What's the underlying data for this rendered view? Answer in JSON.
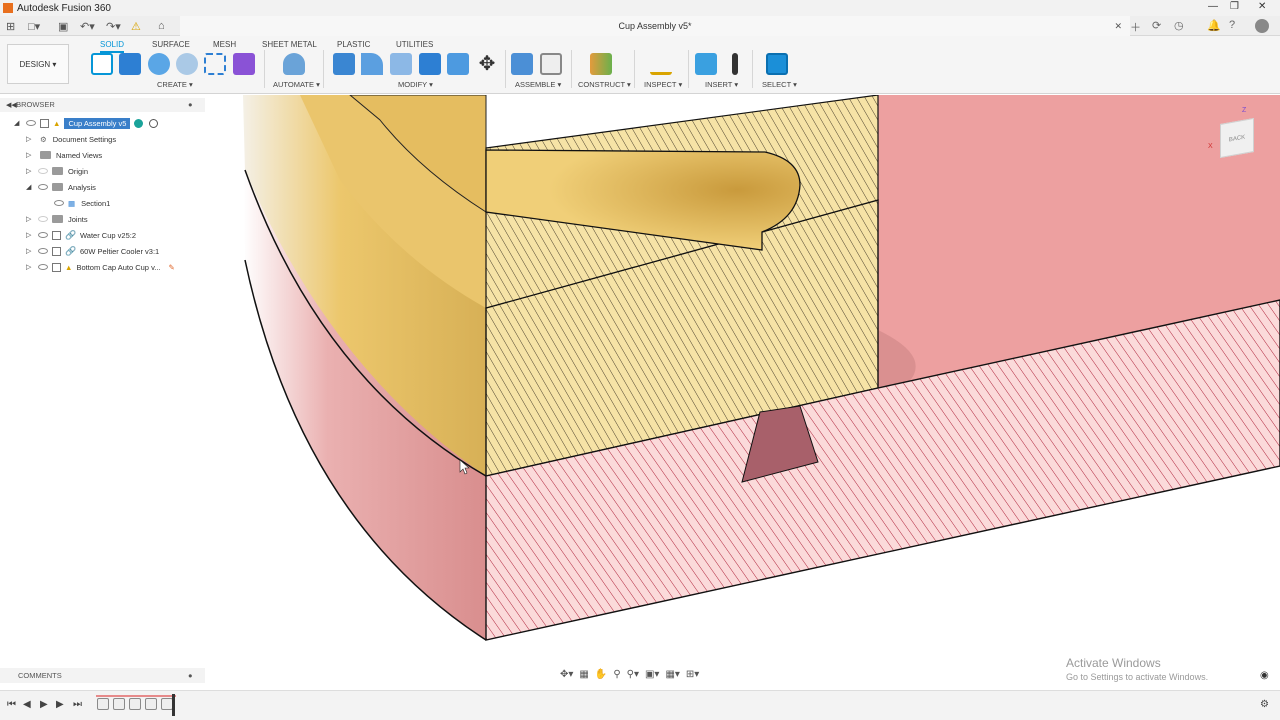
{
  "app": {
    "title": "Autodesk Fusion 360",
    "document_tab": "Cup Assembly v5*"
  },
  "ribbon": {
    "workspace": "DESIGN",
    "tabs": [
      "SOLID",
      "SURFACE",
      "MESH",
      "SHEET METAL",
      "PLASTIC",
      "UTILITIES"
    ],
    "active_tab": "SOLID",
    "groups": [
      "CREATE",
      "AUTOMATE",
      "MODIFY",
      "ASSEMBLE",
      "CONSTRUCT",
      "INSPECT",
      "INSERT",
      "SELECT"
    ]
  },
  "browser": {
    "header": "BROWSER",
    "root": "Cup Assembly v5",
    "items": [
      {
        "label": "Document Settings"
      },
      {
        "label": "Named Views"
      },
      {
        "label": "Origin"
      },
      {
        "label": "Analysis"
      },
      {
        "label": "Section1"
      },
      {
        "label": "Joints"
      },
      {
        "label": "Water Cup v25:2"
      },
      {
        "label": "60W Peltier Cooler v3:1"
      },
      {
        "label": "Bottom Cap Auto Cup v..."
      }
    ]
  },
  "viewcube": {
    "face": "BACK",
    "axis_z": "Z",
    "axis_x": "X"
  },
  "comments": {
    "label": "COMMENTS"
  },
  "watermark": {
    "line1": "Activate Windows",
    "line2": "Go to Settings to activate Windows."
  },
  "colors": {
    "accent": "#0696d7",
    "section_yellow": "#ebc76c",
    "section_pink": "#e9a0a0",
    "warning": "#f2c21b"
  }
}
